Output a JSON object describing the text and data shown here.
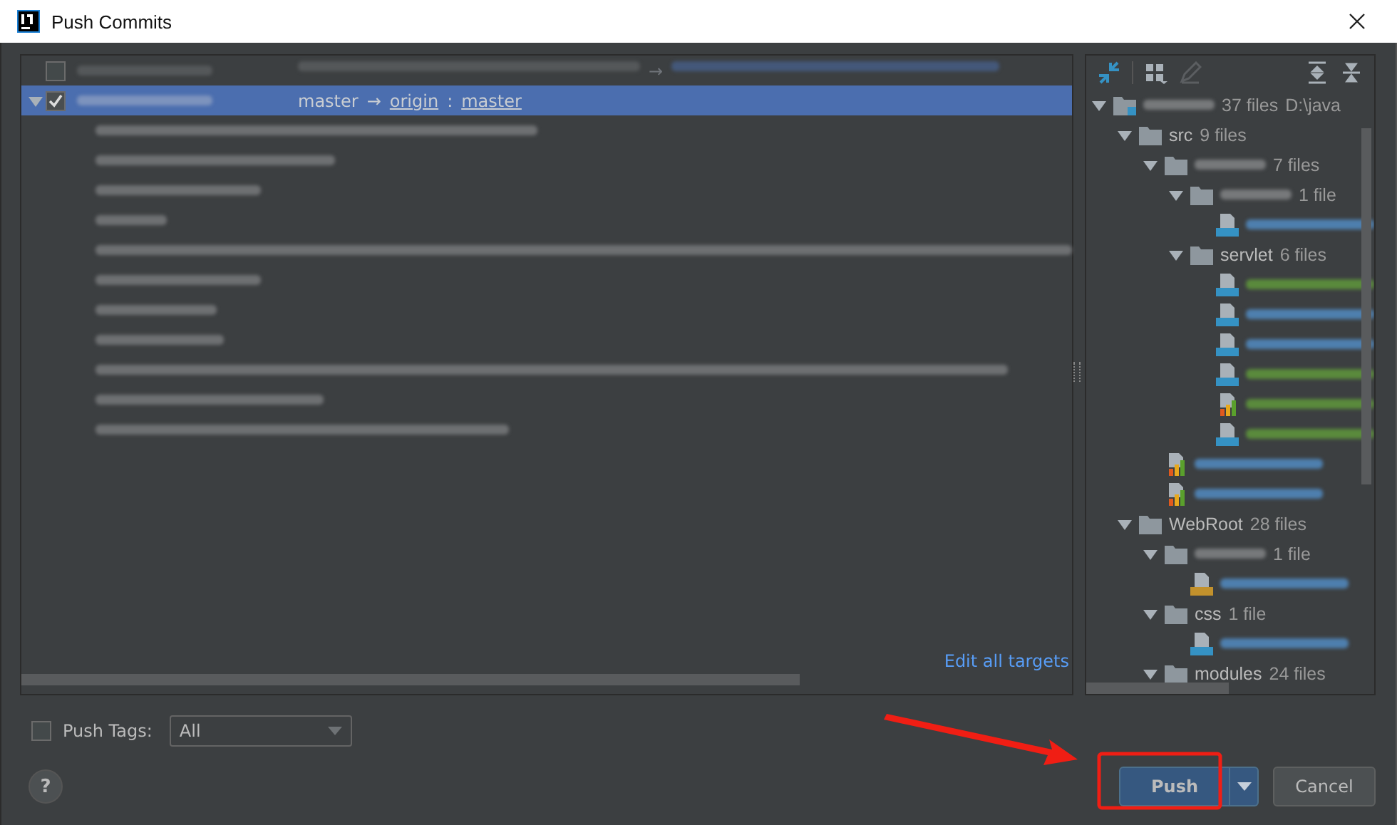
{
  "window": {
    "title": "Push Commits"
  },
  "commits": [
    {
      "selected": false,
      "checked": false,
      "expanded": false,
      "arrow": "→"
    },
    {
      "selected": true,
      "checked": true,
      "expanded": true,
      "source": "master",
      "arrow": "→",
      "remote": "origin",
      "separator": ":",
      "target": "master"
    }
  ],
  "edit_targets_link": "Edit all targets",
  "tree": [
    {
      "kind": "folder",
      "count": "37 files",
      "path": "D:\\java",
      "expanded": true,
      "children": [
        {
          "kind": "folder",
          "name": "src",
          "count": "9 files",
          "expanded": true,
          "children": [
            {
              "kind": "folder",
              "count": "7 files",
              "expanded": true,
              "children": [
                {
                  "kind": "folder",
                  "count": "1 file",
                  "expanded": true,
                  "children": [
                    {
                      "kind": "java",
                      "color": "#4e7fae"
                    }
                  ]
                },
                {
                  "kind": "folder",
                  "name": "servlet",
                  "count": "6 files",
                  "expanded": true,
                  "children": [
                    {
                      "kind": "java",
                      "color": "#5a8a3c"
                    },
                    {
                      "kind": "java",
                      "color": "#4e7fae"
                    },
                    {
                      "kind": "java",
                      "color": "#4e7fae"
                    },
                    {
                      "kind": "java",
                      "color": "#5a8a3c"
                    },
                    {
                      "kind": "chart",
                      "color": "#5a8a3c"
                    },
                    {
                      "kind": "java",
                      "color": "#5a8a3c"
                    }
                  ]
                }
              ]
            },
            {
              "kind": "chart",
              "color": "#4e7fae"
            },
            {
              "kind": "chart",
              "color": "#4e7fae"
            }
          ]
        },
        {
          "kind": "folder",
          "name": "WebRoot",
          "count": "28 files",
          "expanded": true,
          "children": [
            {
              "kind": "folder",
              "count": "1 file",
              "expanded": true,
              "children": [
                {
                  "kind": "js",
                  "color": "#4e7fae"
                }
              ]
            },
            {
              "kind": "folder",
              "name": "css",
              "count": "1 file",
              "expanded": true,
              "children": [
                {
                  "kind": "css",
                  "color": "#4e7fae"
                }
              ]
            },
            {
              "kind": "folder",
              "name": "modules",
              "count": "24 files",
              "expanded": true
            }
          ]
        }
      ]
    }
  ],
  "push_tags": {
    "label": "Push Tags:",
    "checked": false,
    "option": "All"
  },
  "help": "?",
  "buttons": [
    {
      "kind": "push",
      "label": "Push"
    },
    {
      "kind": "cancel",
      "label": "Cancel"
    }
  ]
}
